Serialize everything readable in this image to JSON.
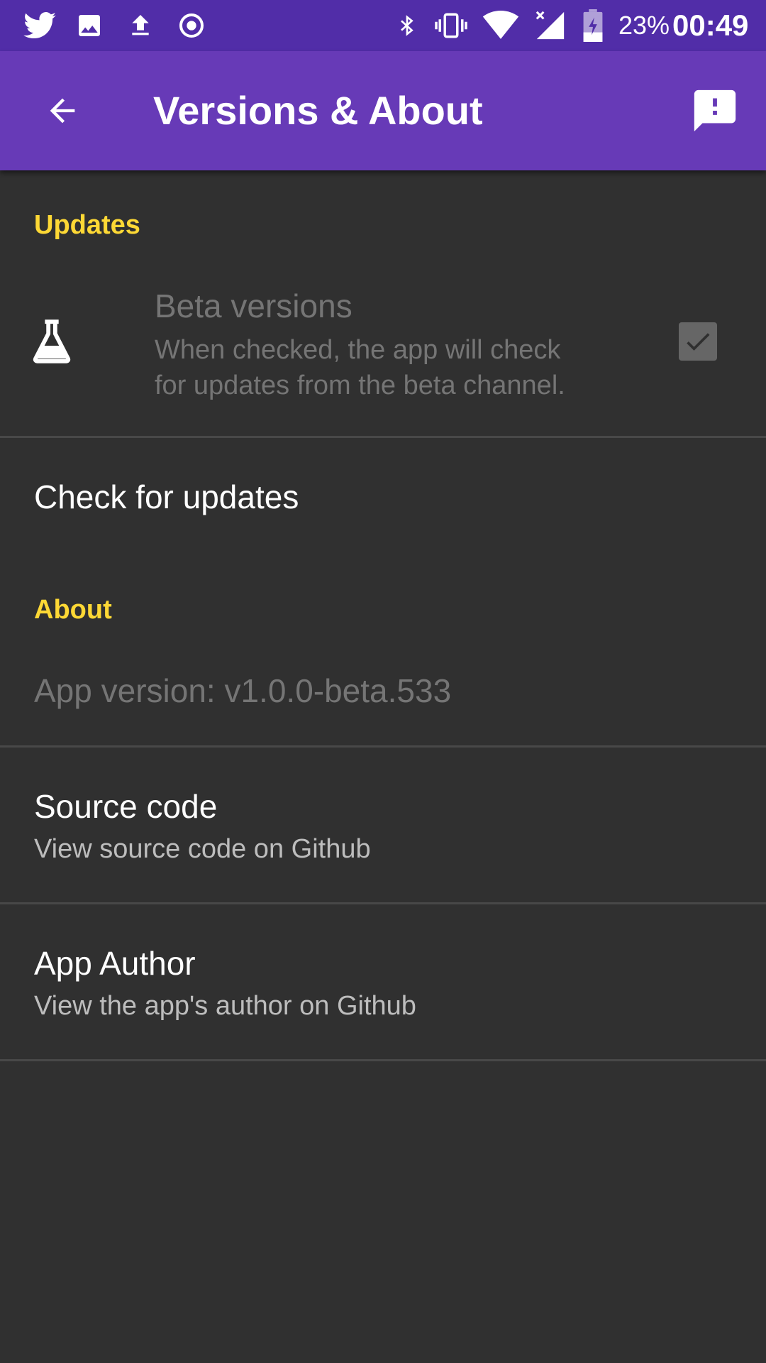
{
  "status_bar": {
    "battery_percent": "23%",
    "time": "00:49",
    "icons": [
      "twitter-icon",
      "image-icon",
      "upload-icon",
      "record-icon",
      "bluetooth-icon",
      "vibrate-icon",
      "wifi-icon",
      "cell-signal-icon",
      "battery-icon"
    ]
  },
  "app_bar": {
    "title": "Versions & About",
    "back_icon": "arrow-back-icon",
    "feedback_icon": "feedback-icon"
  },
  "sections": {
    "updates": {
      "header": "Updates",
      "beta": {
        "title": "Beta versions",
        "summary_line1": "When checked, the app will check",
        "summary_line2": "for updates from the beta channel.",
        "checked": true,
        "icon": "flask-icon"
      },
      "check_updates": {
        "title": "Check for updates"
      }
    },
    "about": {
      "header": "About",
      "version": "App version: v1.0.0-beta.533",
      "source_code": {
        "title": "Source code",
        "summary": "View source code on Github"
      },
      "app_author": {
        "title": "App Author",
        "summary": "View the app's author on Github"
      }
    }
  },
  "colors": {
    "status_bar": "#512da8",
    "app_bar": "#673ab7",
    "background": "#303030",
    "accent": "#fdd835"
  }
}
